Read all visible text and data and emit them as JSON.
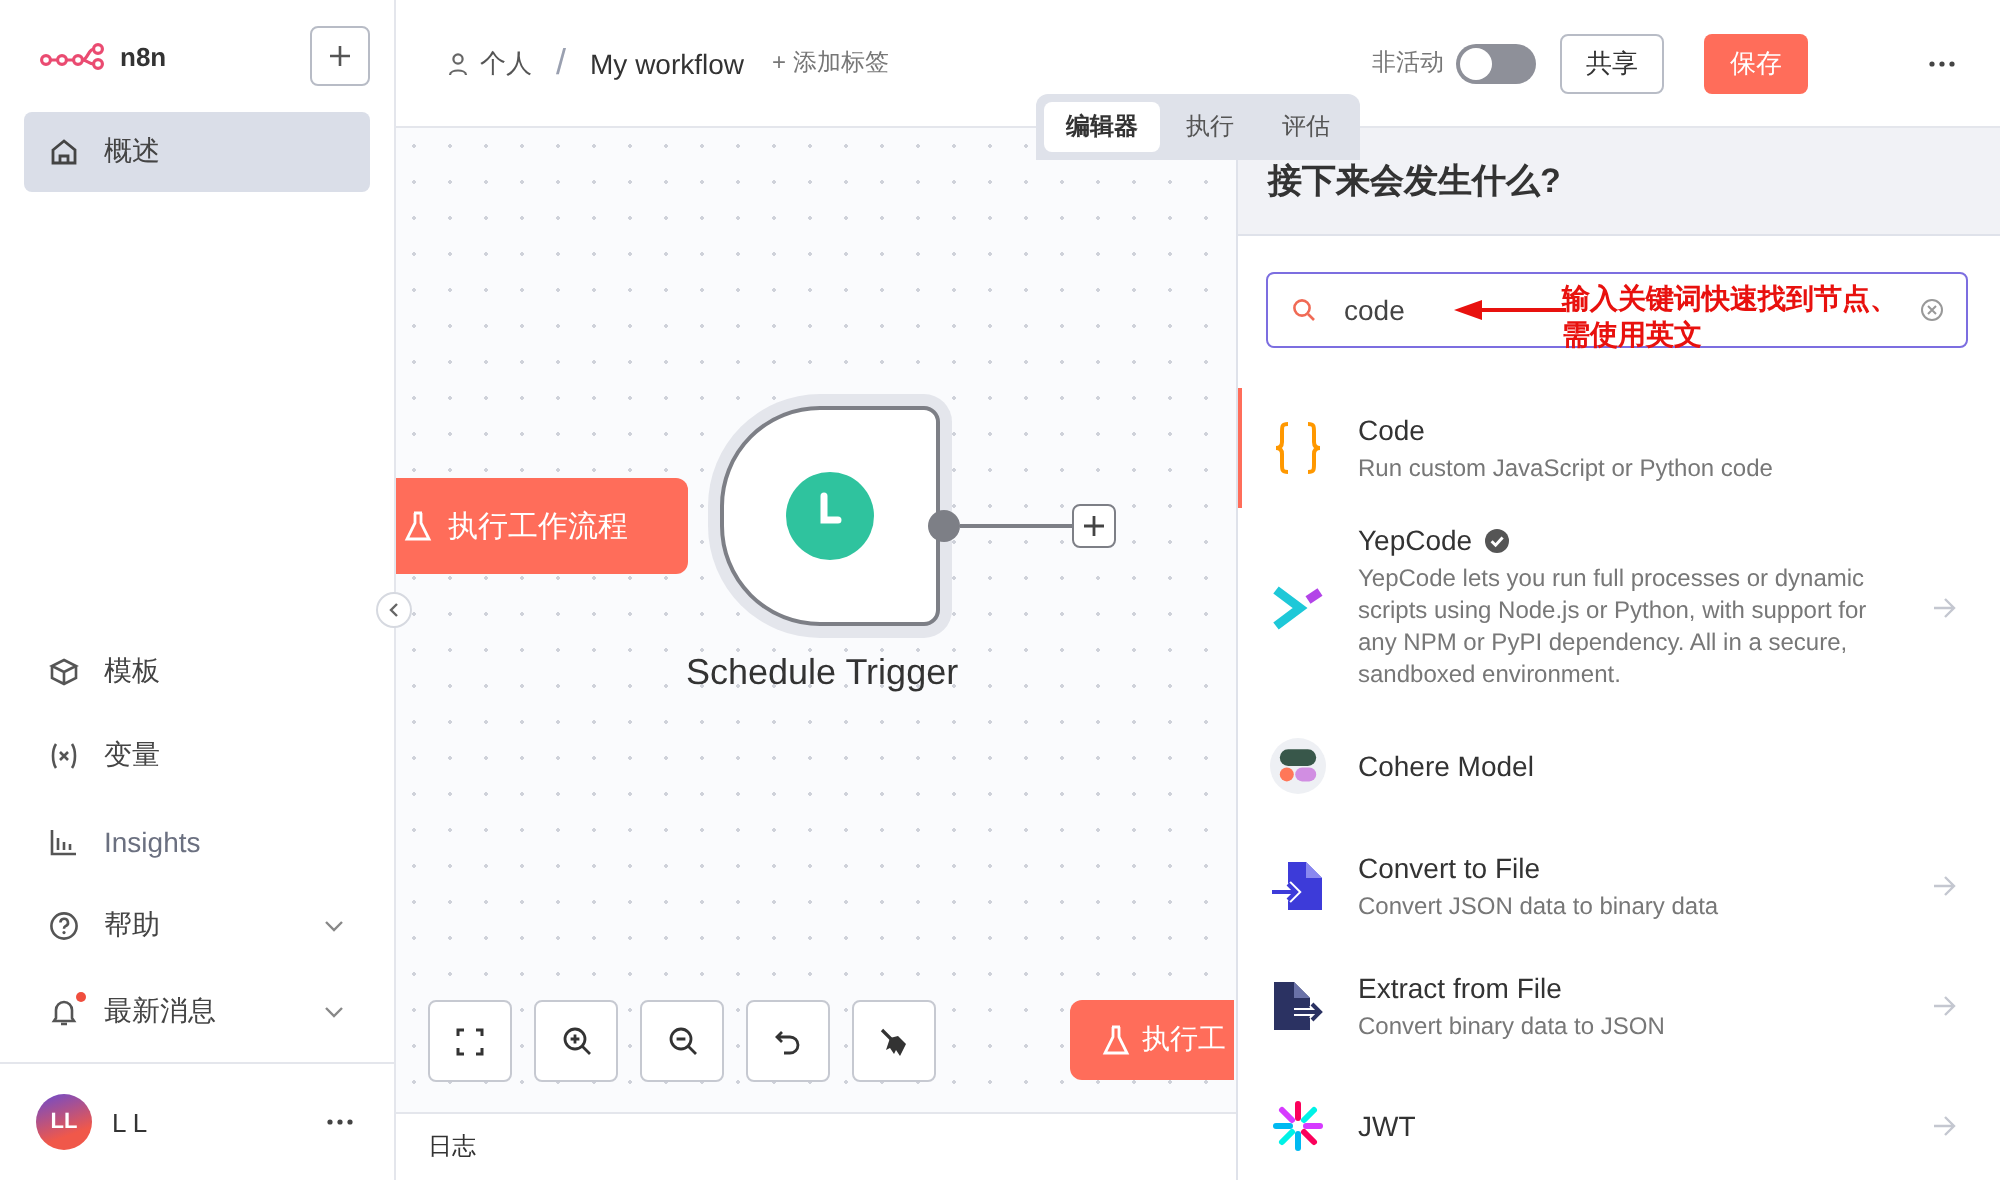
{
  "sidebar": {
    "logo": "n8n",
    "items_top": [
      {
        "label": "概述",
        "selected": true
      }
    ],
    "items_bottom": [
      {
        "label": "模板",
        "expandable": false,
        "notification": false
      },
      {
        "label": "变量",
        "expandable": false,
        "notification": false
      },
      {
        "label": "Insights",
        "expandable": false,
        "notification": false
      },
      {
        "label": "帮助",
        "expandable": true,
        "notification": false
      },
      {
        "label": "最新消息",
        "expandable": true,
        "notification": true
      }
    ],
    "user": {
      "initials": "LL",
      "name": "L L"
    }
  },
  "header": {
    "project": "个人",
    "separator": "/",
    "workflow": "My workflow",
    "add_tag": "+ 添加标签",
    "active_label": "非活动",
    "active": false,
    "share": "共享",
    "save": "保存"
  },
  "tabs": [
    {
      "label": "编辑器",
      "selected": true
    },
    {
      "label": "执行",
      "selected": false
    },
    {
      "label": "评估",
      "selected": false
    }
  ],
  "canvas": {
    "node": {
      "name": "Schedule Trigger"
    },
    "execute_buttons": [
      {
        "label": "执行工作流程"
      },
      {
        "label": "执行工"
      }
    ]
  },
  "log_bar": {
    "label": "日志"
  },
  "panel": {
    "title": "接下来会发生什么?",
    "search": {
      "value": "code"
    },
    "annotation": {
      "lines": [
        "输入关键词快速找到节点、",
        "需使用英文"
      ]
    },
    "nodes": [
      {
        "kind": "code",
        "name": "Code",
        "description": "Run custom JavaScript or Python code",
        "verified": false,
        "selected": true,
        "arrow": false
      },
      {
        "kind": "yepcode",
        "name": "YepCode",
        "description": "YepCode lets you run full processes or dynamic scripts using Node.js or Python, with support for any NPM or PyPI dependency. All in a secure, sandboxed environment.",
        "verified": true,
        "selected": false,
        "arrow": true
      },
      {
        "kind": "cohere",
        "name": "Cohere Model",
        "verified": false,
        "selected": false,
        "arrow": false
      },
      {
        "kind": "convert",
        "name": "Convert to File",
        "description": "Convert JSON data to binary data",
        "verified": false,
        "selected": false,
        "arrow": true
      },
      {
        "kind": "extract",
        "name": "Extract from File",
        "description": "Convert binary data to JSON",
        "verified": false,
        "selected": false,
        "arrow": true
      },
      {
        "kind": "jwt",
        "name": "JWT",
        "verified": false,
        "selected": false,
        "arrow": true
      }
    ]
  }
}
